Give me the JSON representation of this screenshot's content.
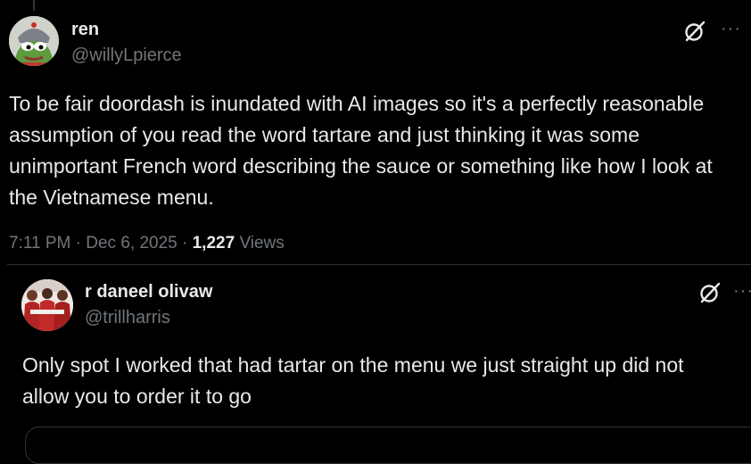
{
  "main_post": {
    "display_name": "ren",
    "handle": "@willyLpierce",
    "text": "To be fair doordash is inundated with AI images so it's a perfectly reasonable assumption of you read the word tartare and just thinking it was some unimportant French word describing the sauce or something like how I look at the Vietnamese menu.",
    "time": "7:11 PM",
    "date": "Dec 6, 2025",
    "views_count": "1,227",
    "views_label": "Views",
    "separator": "·"
  },
  "quote_post": {
    "display_name": "r daneel olivaw",
    "handle": "@trillharris",
    "text": "Only spot I worked that had tartar on the menu we just straight up did not allow you to order it to go"
  },
  "icons": {
    "grok": "grok-icon",
    "more": "more-icon",
    "more_glyph": "···"
  },
  "colors": {
    "background": "#000000",
    "primary_text": "#e7e9ea",
    "secondary_text": "#71767b",
    "border": "#2f3336"
  }
}
